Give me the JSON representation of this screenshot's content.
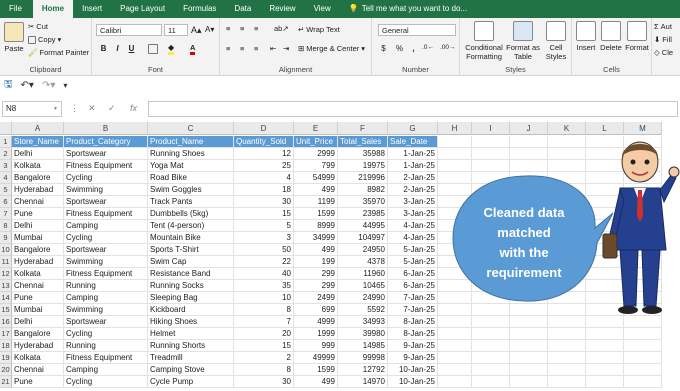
{
  "tabs": {
    "file": "File",
    "home": "Home",
    "insert": "Insert",
    "page_layout": "Page Layout",
    "formulas": "Formulas",
    "data": "Data",
    "review": "Review",
    "view": "View",
    "tell": "Tell me what you want to do..."
  },
  "ribbon": {
    "clipboard": {
      "paste": "Paste",
      "cut": "Cut",
      "copy": "Copy",
      "format_painter": "Format Painter",
      "label": "Clipboard"
    },
    "font": {
      "name": "Calibri",
      "size": "11",
      "label": "Font",
      "bold": "B",
      "italic": "I",
      "underline": "U"
    },
    "alignment": {
      "wrap": "Wrap Text",
      "merge": "Merge & Center",
      "label": "Alignment"
    },
    "number": {
      "format": "General",
      "currency": "$",
      "percent": "%",
      "comma": ",",
      "label": "Number"
    },
    "styles": {
      "cond": "Conditional Formatting",
      "table": "Format as Table",
      "cell": "Cell Styles",
      "label": "Styles"
    },
    "cells": {
      "insert": "Insert",
      "delete": "Delete",
      "format": "Format",
      "label": "Cells"
    },
    "editing": {
      "autosum": "Aut",
      "fill": "Fill",
      "clear": "Cle"
    }
  },
  "formula_bar": {
    "name_box": "N8",
    "fx": "fx",
    "cancel": "✕",
    "enter": "✓",
    "value": ""
  },
  "columns": [
    "A",
    "B",
    "C",
    "D",
    "E",
    "F",
    "G",
    "H",
    "I",
    "J",
    "K",
    "L",
    "M"
  ],
  "header": [
    "Store_Name",
    "Product_Category",
    "Product_Name",
    "Quantity_Sold",
    "Unit_Price",
    "Total_Sales",
    "Sale_Date"
  ],
  "rows": [
    [
      "Delhi",
      "Sportswear",
      "Running Shoes",
      "12",
      "2999",
      "35988",
      "1-Jan-25"
    ],
    [
      "Kolkata",
      "Fitness Equipment",
      "Yoga Mat",
      "25",
      "799",
      "19975",
      "1-Jan-25"
    ],
    [
      "Bangalore",
      "Cycling",
      "Road Bike",
      "4",
      "54999",
      "219996",
      "2-Jan-25"
    ],
    [
      "Hyderabad",
      "Swimming",
      "Swim Goggles",
      "18",
      "499",
      "8982",
      "2-Jan-25"
    ],
    [
      "Chennai",
      "Sportswear",
      "Track Pants",
      "30",
      "1199",
      "35970",
      "3-Jan-25"
    ],
    [
      "Pune",
      "Fitness Equipment",
      "Dumbbells (5kg)",
      "15",
      "1599",
      "23985",
      "3-Jan-25"
    ],
    [
      "Delhi",
      "Camping",
      "Tent (4-person)",
      "5",
      "8999",
      "44995",
      "4-Jan-25"
    ],
    [
      "Mumbai",
      "Cycling",
      "Mountain Bike",
      "3",
      "34999",
      "104997",
      "4-Jan-25"
    ],
    [
      "Bangalore",
      "Sportswear",
      "Sports T-Shirt",
      "50",
      "499",
      "24950",
      "5-Jan-25"
    ],
    [
      "Hyderabad",
      "Swimming",
      "Swim Cap",
      "22",
      "199",
      "4378",
      "5-Jan-25"
    ],
    [
      "Kolkata",
      "Fitness Equipment",
      "Resistance Band",
      "40",
      "299",
      "11960",
      "6-Jan-25"
    ],
    [
      "Chennai",
      "Running",
      "Running Socks",
      "35",
      "299",
      "10465",
      "6-Jan-25"
    ],
    [
      "Pune",
      "Camping",
      "Sleeping Bag",
      "10",
      "2499",
      "24990",
      "7-Jan-25"
    ],
    [
      "Mumbai",
      "Swimming",
      "Kickboard",
      "8",
      "699",
      "5592",
      "7-Jan-25"
    ],
    [
      "Delhi",
      "Sportswear",
      "Hiking Shoes",
      "7",
      "4999",
      "34993",
      "8-Jan-25"
    ],
    [
      "Bangalore",
      "Cycling",
      "Helmet",
      "20",
      "1999",
      "39980",
      "8-Jan-25"
    ],
    [
      "Hyderabad",
      "Running",
      "Running Shorts",
      "15",
      "999",
      "14985",
      "9-Jan-25"
    ],
    [
      "Kolkata",
      "Fitness Equipment",
      "Treadmill",
      "2",
      "49999",
      "99998",
      "9-Jan-25"
    ],
    [
      "Chennai",
      "Camping",
      "Camping Stove",
      "8",
      "1599",
      "12792",
      "10-Jan-25"
    ],
    [
      "Pune",
      "Cycling",
      "Cycle Pump",
      "30",
      "499",
      "14970",
      "10-Jan-25"
    ]
  ],
  "callout": {
    "line1": "Cleaned data",
    "line2": "matched",
    "line3": "with the",
    "line4": "requirement"
  },
  "colors": {
    "excel_green": "#217346",
    "header_fill": "#5b9bd5",
    "callout_blue": "#5b9bd5",
    "suit": "#24408e"
  }
}
